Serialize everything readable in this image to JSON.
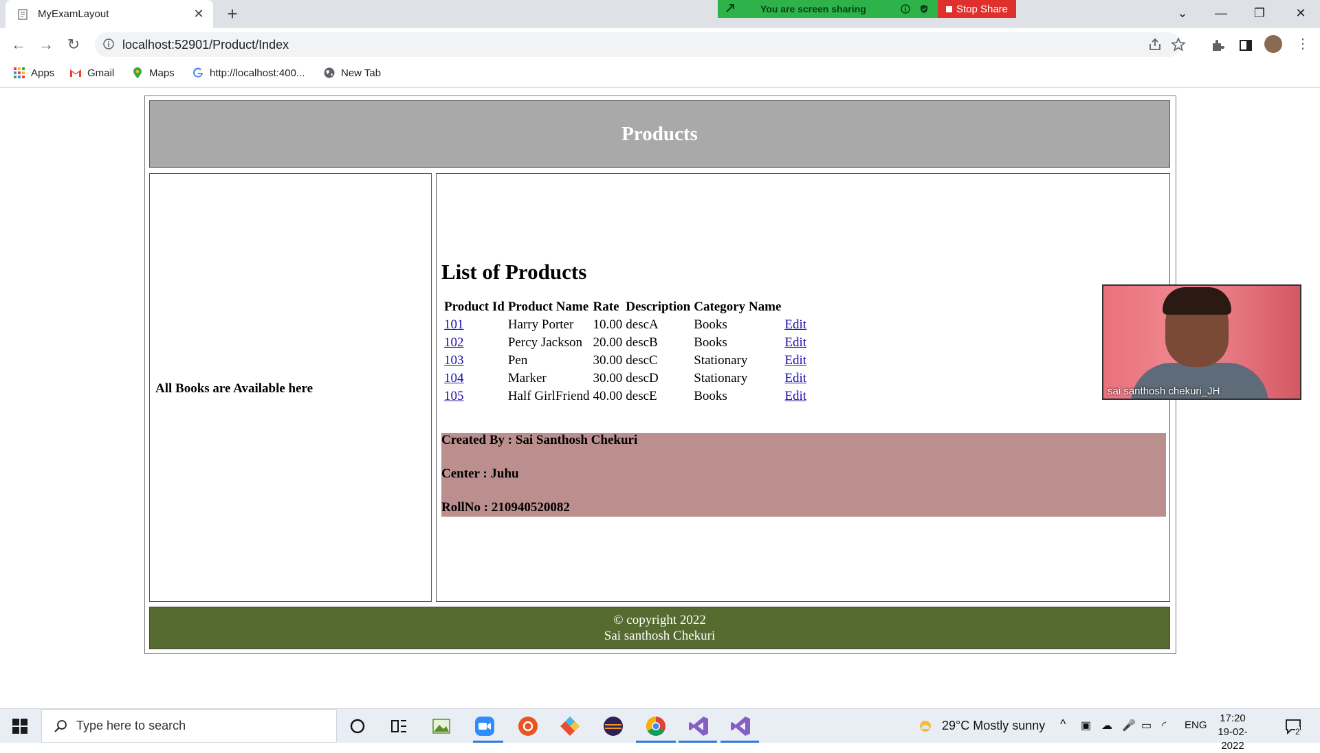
{
  "browser": {
    "tab_title": "MyExamLayout",
    "url": "localhost:52901/Product/Index",
    "screen_share_text": "You are screen sharing",
    "stop_share_label": "Stop Share",
    "bookmarks": [
      "Apps",
      "Gmail",
      "Maps",
      "http://localhost:400...",
      "New Tab"
    ]
  },
  "page": {
    "header": "Products",
    "left_text": "All Books are Available here",
    "list_title": "List of Products",
    "columns": [
      "Product Id",
      "Product Name",
      "Rate",
      "Description",
      "Category Name"
    ],
    "rows": [
      {
        "id": "101",
        "name": "Harry Porter",
        "rate": "10.00",
        "desc": "descA",
        "category": "Books",
        "action": "Edit"
      },
      {
        "id": "102",
        "name": "Percy Jackson",
        "rate": "20.00",
        "desc": "descB",
        "category": "Books",
        "action": "Edit"
      },
      {
        "id": "103",
        "name": "Pen",
        "rate": "30.00",
        "desc": "descC",
        "category": "Stationary",
        "action": "Edit"
      },
      {
        "id": "104",
        "name": "Marker",
        "rate": "30.00",
        "desc": "descD",
        "category": "Stationary",
        "action": "Edit"
      },
      {
        "id": "105",
        "name": "Half GirlFriend",
        "rate": "40.00",
        "desc": "descE",
        "category": "Books",
        "action": "Edit"
      }
    ],
    "created_by": "Created By : Sai Santhosh Chekuri",
    "center": "Center : Juhu",
    "rollno": "RollNo : 210940520082",
    "footer_line1": "© copyright 2022",
    "footer_line2": "Sai santhosh Chekuri"
  },
  "video": {
    "participant_name": "sai santhosh chekuri_JH"
  },
  "taskbar": {
    "search_placeholder": "Type here to search",
    "weather": "29°C  Mostly sunny",
    "language": "ENG",
    "time": "17:20",
    "date": "19-02-2022",
    "notification_count": "2"
  },
  "colors": {
    "header_bg": "#a9a9a9",
    "created_bg": "#bc8f8f",
    "footer_bg": "#556b2f",
    "share_green": "#2db34a",
    "stop_red": "#e0302e"
  }
}
